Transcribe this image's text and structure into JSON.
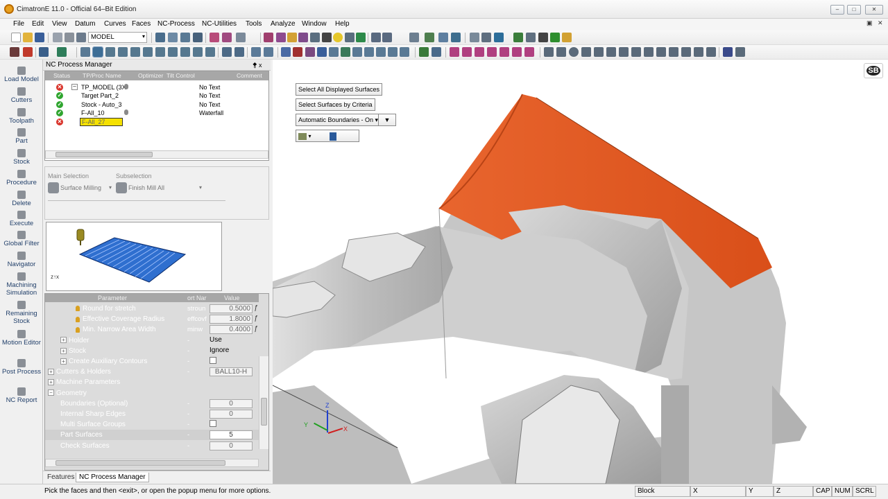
{
  "window": {
    "title": "CimatronE 11.0 - Official 64–Bit Edition"
  },
  "menu": {
    "items": [
      "File",
      "Edit",
      "View",
      "Datum",
      "Curves",
      "Faces",
      "NC-Process",
      "NC-Utilities",
      "Tools",
      "Analyze",
      "Window",
      "Help"
    ],
    "model_dropdown": "MODEL"
  },
  "left_toolbar": {
    "items": [
      "Load Model",
      "Cutters",
      "Toolpath",
      "Part",
      "Stock",
      "Procedure",
      "Delete",
      "Execute",
      "Global Filter",
      "Navigator",
      "Machining Simulation",
      "Remaining Stock",
      "Motion Editor",
      "Post Process",
      "NC Report"
    ]
  },
  "nc_panel": {
    "title": "NC Process Manager",
    "pin": "⯞ x",
    "columns": [
      "Status",
      "TP/Proc Name",
      "Optimizer",
      "Tilt Control",
      "Comment"
    ],
    "rows": [
      {
        "status": "error",
        "name": "TP_MODEL (3X",
        "comment": "No Text",
        "bulb": true
      },
      {
        "status": "ok",
        "name": "Target Part_2",
        "comment": "No Text",
        "bulb": false
      },
      {
        "status": "ok",
        "name": "Stock - Auto_3",
        "comment": "No Text",
        "bulb": false
      },
      {
        "status": "ok",
        "name": "F-All_10",
        "comment": "Waterfall",
        "bulb": true
      },
      {
        "status": "error",
        "name": "F-All_27",
        "comment": "",
        "bulb": false
      }
    ],
    "main_selection_label": "Main Selection",
    "main_selection_value": "Surface Milling",
    "subselection_label": "Subselection",
    "subselection_value": "Finish Mill All",
    "preview_axes": "z↑x",
    "param_columns": [
      "Parameter",
      "ort Nar",
      "Value"
    ],
    "params": [
      {
        "name": "Round for stretch",
        "short": "stroun",
        "value": "0.5000",
        "level": 3,
        "bulb": true,
        "fx": true,
        "box": true
      },
      {
        "name": "Effective Coverage Radius",
        "short": "effcovf",
        "value": "1.8000",
        "level": 3,
        "bulb": true,
        "fx": true,
        "box": true
      },
      {
        "name": "Min. Narrow Area Width",
        "short": "minw",
        "value": "0.4000",
        "level": 3,
        "bulb": true,
        "fx": true,
        "box": true
      },
      {
        "name": "Holder",
        "short": "-",
        "value": "Use",
        "level": 2,
        "expand": true,
        "box": false
      },
      {
        "name": "Stock",
        "short": "-",
        "value": "Ignore",
        "level": 2,
        "expand": true,
        "box": false
      },
      {
        "name": "Create Auxiliary Contours",
        "short": "-",
        "value": "",
        "level": 2,
        "expand": true,
        "checkbox": true
      },
      {
        "name": "Cutters & Holders",
        "short": "-",
        "value": "BALL10-H",
        "level": 1,
        "expand": true,
        "box": true
      },
      {
        "name": "Machine Parameters",
        "short": "",
        "value": "",
        "level": 1,
        "expand": true
      },
      {
        "name": "Geometry",
        "short": "",
        "value": "",
        "level": 1,
        "collapse": true
      },
      {
        "name": "Boundaries (Optional)",
        "short": "-",
        "value": "0",
        "level": 2,
        "box": true
      },
      {
        "name": "Internal Sharp Edges",
        "short": "-",
        "value": "0",
        "level": 2,
        "box": true
      },
      {
        "name": "Multi Surface Groups",
        "short": "-",
        "value": "",
        "level": 2,
        "checkbox": true
      },
      {
        "name": "Part Surfaces",
        "short": "-",
        "value": "5",
        "level": 2,
        "box": true,
        "active": true
      },
      {
        "name": "Check Surfaces",
        "short": "-",
        "value": "0",
        "level": 2,
        "box": true
      }
    ],
    "tabs": [
      "Features",
      "NC Process Manager"
    ]
  },
  "viewport": {
    "buttons": {
      "select_all": "Select All Displayed Surfaces",
      "by_criteria": "Select Surfaces by Criteria",
      "boundaries": "Automatic Boundaries - On ▾"
    },
    "logo": "SB",
    "axis_labels": {
      "z": "Z",
      "y": "Y",
      "x": "X"
    },
    "highlight_color": "#e0551f"
  },
  "status": {
    "message": "Pick the faces and then <exit>, or open the popup menu for more options.",
    "cells": [
      "Block",
      "X",
      "Y",
      "Z",
      "CAP",
      "NUM",
      "SCRL"
    ]
  }
}
